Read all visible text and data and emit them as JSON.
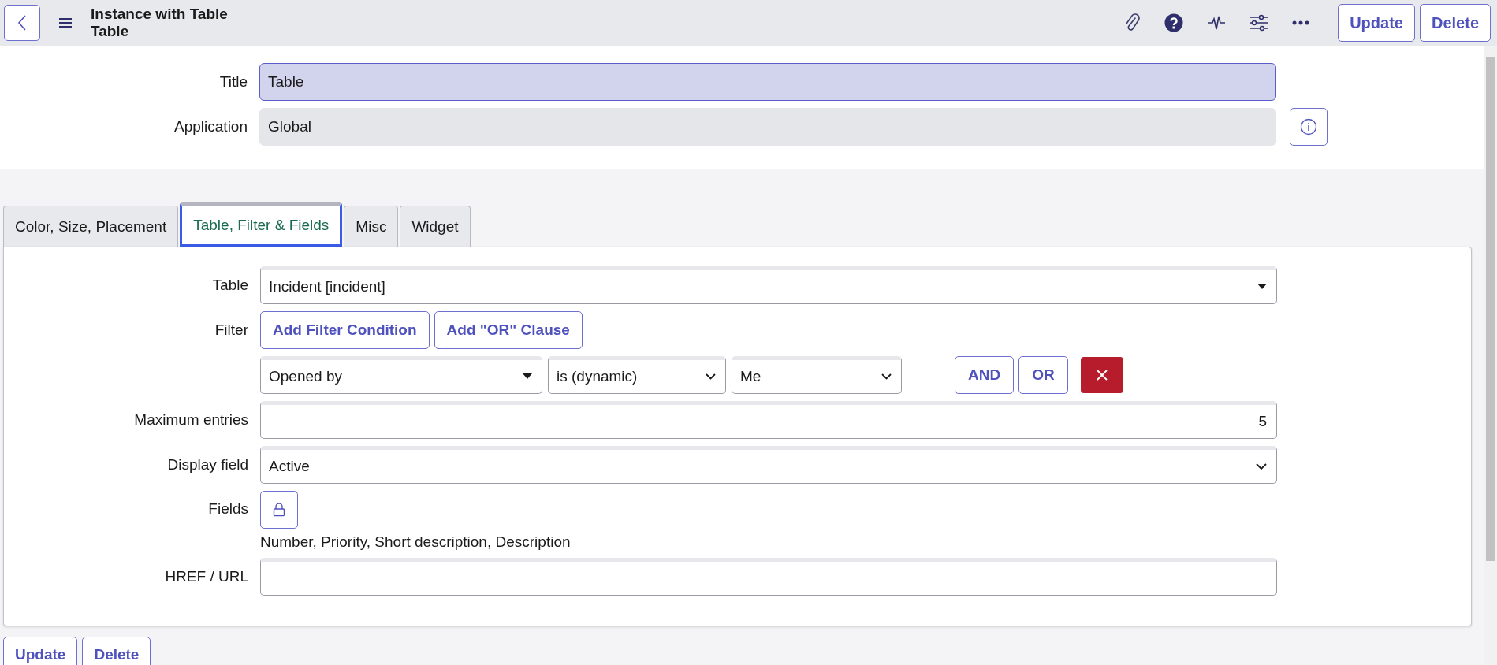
{
  "header": {
    "title_lines": [
      "Instance with Table",
      "Table"
    ],
    "buttons": [
      "Update",
      "Delete"
    ]
  },
  "record": [
    {
      "label": "Title",
      "value": "Table",
      "readonly": false,
      "info": false
    },
    {
      "label": "Application",
      "value": "Global",
      "readonly": true,
      "info": true
    }
  ],
  "tabs": [
    {
      "label": "Color, Size, Placement",
      "selected": false
    },
    {
      "label": "Table, Filter & Fields",
      "selected": true
    },
    {
      "label": "Misc",
      "selected": false
    },
    {
      "label": "Widget",
      "selected": false
    }
  ],
  "form": [
    {
      "kind": "reference",
      "label": "Table",
      "value": "Incident [incident]"
    },
    {
      "kind": "filter",
      "label": "Filter",
      "buttons": [
        "Add Filter Condition",
        "Add \"OR\" Clause"
      ],
      "condition": {
        "field": "Opened by",
        "operator": "is (dynamic)",
        "value": "Me",
        "connectors": [
          "AND",
          "OR"
        ]
      }
    },
    {
      "kind": "number",
      "label": "Maximum entries",
      "value": "5"
    },
    {
      "kind": "select",
      "label": "Display field",
      "value": "Active"
    },
    {
      "kind": "fieldlist",
      "label": "Fields",
      "value": "Number, Priority, Short description, Description"
    },
    {
      "kind": "text",
      "label": "HREF / URL"
    }
  ],
  "footer_buttons": [
    "Update",
    "Delete"
  ]
}
